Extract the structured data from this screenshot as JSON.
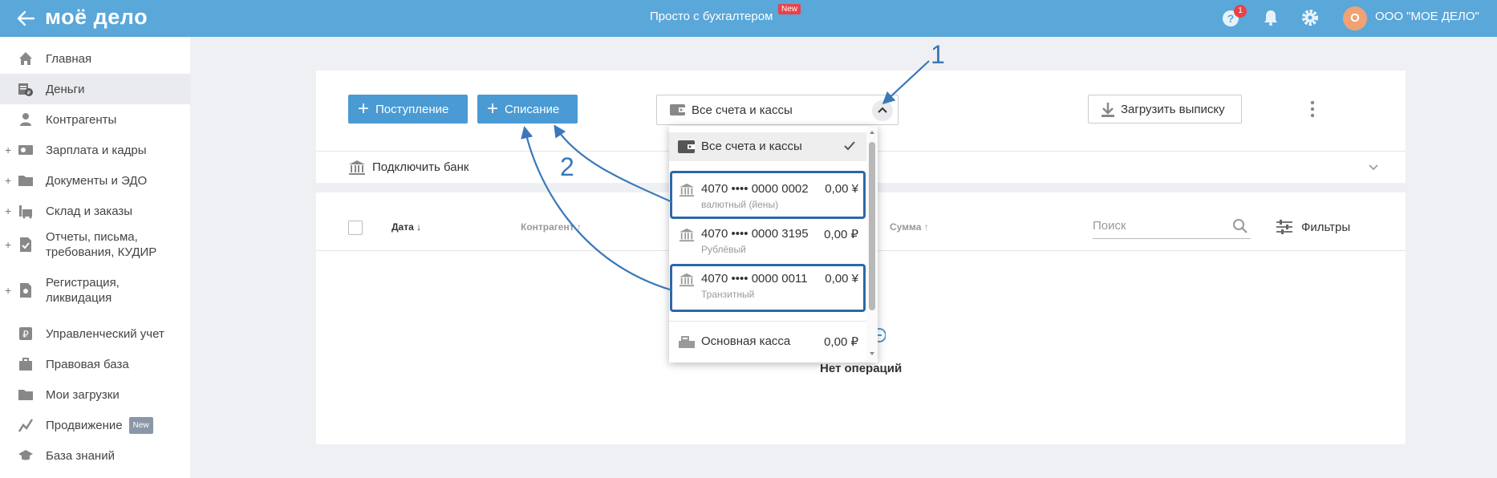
{
  "header": {
    "logo": "моё дело",
    "center_title": "Просто с бухгалтером",
    "new_tag": "New",
    "help_badge": "1",
    "avatar_letter": "О",
    "org_name": "ООО \"МОЕ ДЕЛО\""
  },
  "sidebar": {
    "items": [
      {
        "label": "Главная",
        "icon": "home-icon"
      },
      {
        "label": "Деньги",
        "icon": "money-icon"
      },
      {
        "label": "Контрагенты",
        "icon": "contractors-icon"
      },
      {
        "label": "Зарплата и кадры",
        "icon": "salary-icon"
      },
      {
        "label": "Документы и ЭДО",
        "icon": "documents-icon"
      },
      {
        "label": "Склад и заказы",
        "icon": "warehouse-icon"
      },
      {
        "label": "Отчеты, письма,",
        "label2": "требования, КУДИР",
        "icon": "reports-icon"
      },
      {
        "label": "Регистрация,",
        "label2": "ликвидация",
        "icon": "registration-icon"
      },
      {
        "label": "Управленческий учет",
        "icon": "management-icon"
      },
      {
        "label": "Правовая база",
        "icon": "legal-icon"
      },
      {
        "label": "Мои загрузки",
        "icon": "downloads-icon"
      },
      {
        "label": "Продвижение",
        "icon": "promotion-icon",
        "tag": "New"
      },
      {
        "label": "База знаний",
        "icon": "knowledge-icon"
      }
    ]
  },
  "toolbar": {
    "income_label": "Поступление",
    "expense_label": "Списание",
    "account_select": "Все счета и кассы",
    "upload_label": "Загрузить выписку"
  },
  "connect_bank": "Подключить банк",
  "table": {
    "col_date": "Дата ↓",
    "col_contractor": "Контрагент ↑",
    "col_sum": "Сумма ↑",
    "search_placeholder": "Поиск",
    "filters_label": "Фильтры",
    "empty": "Нет операций"
  },
  "dropdown": {
    "all": "Все счета и кассы",
    "accounts": [
      {
        "number": "4070 •••• 0000 0002",
        "sum": "0,00 ¥",
        "type": "валютный (йены)"
      },
      {
        "number": "4070 •••• 0000 3195",
        "sum": "0,00 ₽",
        "type": "Рублёвый"
      },
      {
        "number": "4070 •••• 0000 0011",
        "sum": "0,00 ¥",
        "type": "Транзитный"
      }
    ],
    "cash": {
      "label": "Основная касса",
      "sum": "0,00 ₽"
    }
  },
  "annotations": {
    "one": "1",
    "two": "2"
  },
  "colors": {
    "header": "#5aa7d9",
    "button": "#4a9ad4",
    "annotation": "#3a78b8",
    "highlight": "#2c68a6"
  }
}
